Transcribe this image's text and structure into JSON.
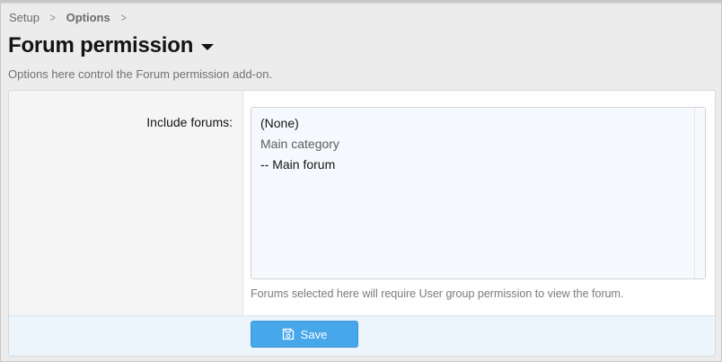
{
  "breadcrumb": {
    "items": [
      "Setup",
      "Options"
    ],
    "separator": ">"
  },
  "header": {
    "title": "Forum permission",
    "description": "Options here control the Forum permission add-on."
  },
  "form": {
    "include_forums_label": "Include forums:",
    "options": [
      {
        "label": "(None)",
        "type": "option"
      },
      {
        "label": "Main category",
        "type": "group"
      },
      {
        "label": "-- Main forum",
        "type": "option"
      }
    ],
    "hint": "Forums selected here will require User group permission to view the forum."
  },
  "footer": {
    "save_label": "Save",
    "save_icon": "floppy-disk-icon"
  },
  "colors": {
    "accent": "#47a7eb",
    "footer_bg": "#edf5fc",
    "listbox_bg": "#f5f9fd"
  }
}
